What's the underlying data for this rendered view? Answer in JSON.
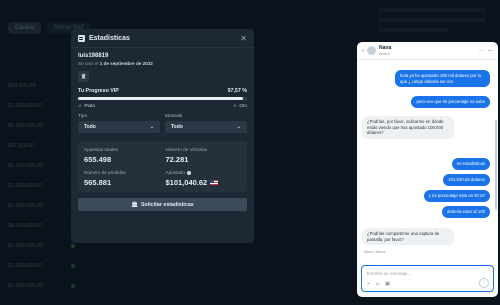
{
  "background": {
    "tabs": [
      "Casino",
      "Sorteo PAF"
    ],
    "rows": [
      {
        "amount": "$29.500,00"
      },
      {
        "amount": "$2.200.000,00"
      },
      {
        "amount": "$4.500.000,00"
      },
      {
        "amount": "$37.500,00"
      },
      {
        "amount": "$2.200.000,00"
      },
      {
        "amount": "$3.500.000,00"
      },
      {
        "amount": "$1.000.000,00"
      },
      {
        "amount": "$4.100.000,00"
      },
      {
        "amount": "$1.000.000,00"
      },
      {
        "amount": "$1.000.000,00"
      },
      {
        "amount": "$1.000.000,00"
      }
    ]
  },
  "modal": {
    "title": "Estadísticas",
    "username": "luis198819",
    "joined_prefix": "Se unió el",
    "joined_date": "1 de septiembre de 2022",
    "progress": {
      "label": "Tu Progreso VIP",
      "percent_text": "97,57 %",
      "fraction": 0.9757,
      "from": "Plata",
      "to": "Oro"
    },
    "filters": [
      {
        "label": "Tipo",
        "value": "Todo"
      },
      {
        "label": "Moneda",
        "value": "Todo"
      }
    ],
    "stats": {
      "apuestas_label": "Apuestas totales",
      "apuestas_value": "655.498",
      "victorias_label": "Número de Victorias",
      "victorias_value": "72.281",
      "perdidas_label": "Número de pérdidas",
      "perdidas_value": "565.881",
      "apostado_label": "Apostado",
      "apostado_value": "$101,040.62"
    },
    "button_label": "Solicitar estadísticas"
  },
  "chat": {
    "agent_name": "Nana",
    "agent_status": "Activo",
    "messages": [
      {
        "dir": "out",
        "text": "hola ya he apostado 100 mil dolares por lo que ¿ rango deberia ser oro"
      },
      {
        "dir": "out",
        "text": "pero veo que mi porcentaje no sube"
      },
      {
        "dir": "in",
        "text": "¿Podrías, por favor, indicarme en dónde estás viendo que has apostado 100.000 dólares?"
      },
      {
        "dir": "out",
        "text": "en estadisticas"
      },
      {
        "dir": "out",
        "text": "101,040.62 dolares"
      },
      {
        "dir": "out",
        "text": "y mi porcentaje esta en 97.57"
      },
      {
        "dir": "out",
        "text": "deberia estar al 100"
      },
      {
        "dir": "in",
        "text": "¿Podrías compartirme una captura de pantalla, por favor?"
      }
    ],
    "last_meta": "Nana • Ahora",
    "input_placeholder": "Escribe un mensaje..."
  }
}
